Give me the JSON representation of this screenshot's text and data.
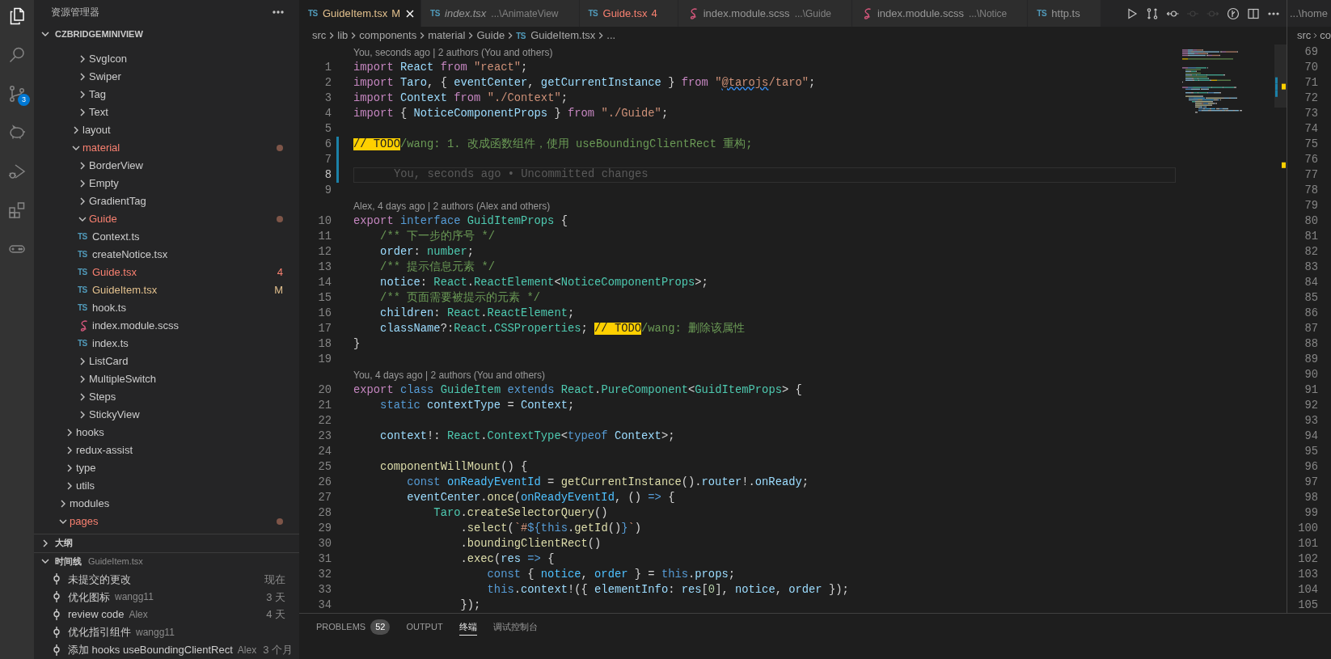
{
  "activity_bar": [
    {
      "kind": "explorer",
      "selected": true
    },
    {
      "kind": "search",
      "selected": false
    },
    {
      "kind": "source-control",
      "selected": false,
      "badge": "3"
    },
    {
      "kind": "piggy",
      "selected": false
    },
    {
      "kind": "run-debug",
      "selected": false
    },
    {
      "kind": "extensions",
      "selected": false
    },
    {
      "kind": "gamepad",
      "selected": false
    }
  ],
  "explorer": {
    "title": "资源管理器",
    "project": {
      "label": "CZBRIDGEMINIVIEW",
      "expanded": true
    },
    "tree": [
      {
        "children": [
          {
            "children": [
              {
                "children": [
                  {
                    "label": "SvgIcon",
                    "kind": "folder",
                    "expanded": false
                  },
                  {
                    "label": "Swiper",
                    "kind": "folder",
                    "expanded": false
                  },
                  {
                    "label": "Tag",
                    "kind": "folder",
                    "expanded": false
                  },
                  {
                    "label": "Text",
                    "kind": "folder",
                    "expanded": false
                  }
                ]
              },
              {
                "label": "layout",
                "kind": "folder",
                "expanded": false
              },
              {
                "label": "material",
                "kind": "folder",
                "expanded": true,
                "problem": true,
                "children": [
                  {
                    "label": "BorderView",
                    "kind": "folder",
                    "expanded": false
                  },
                  {
                    "label": "Empty",
                    "kind": "folder",
                    "expanded": false
                  },
                  {
                    "label": "GradientTag",
                    "kind": "folder",
                    "expanded": false
                  },
                  {
                    "label": "Guide",
                    "kind": "folder",
                    "expanded": true,
                    "problem": true,
                    "children": [
                      {
                        "label": "Context.ts",
                        "kind": "ts-file",
                        "icon": "TS"
                      },
                      {
                        "label": "createNotice.tsx",
                        "kind": "ts-file",
                        "icon": "TS"
                      },
                      {
                        "label": "Guide.tsx",
                        "kind": "ts-file",
                        "icon": "TS",
                        "problem": true,
                        "badge": "4"
                      },
                      {
                        "label": "GuideItem.tsx",
                        "kind": "ts-file",
                        "icon": "TS",
                        "modified": true,
                        "badge": "M"
                      },
                      {
                        "label": "hook.ts",
                        "kind": "ts-file",
                        "icon": "TS"
                      },
                      {
                        "label": "index.module.scss",
                        "kind": "scss-file"
                      },
                      {
                        "label": "index.ts",
                        "kind": "ts-file",
                        "icon": "TS"
                      }
                    ]
                  },
                  {
                    "label": "ListCard",
                    "kind": "folder",
                    "expanded": false
                  },
                  {
                    "label": "MultipleSwitch",
                    "kind": "folder",
                    "expanded": false
                  },
                  {
                    "label": "Steps",
                    "kind": "folder",
                    "expanded": false
                  },
                  {
                    "label": "StickyView",
                    "kind": "folder",
                    "expanded": false
                  }
                ]
              }
            ]
          },
          {
            "label": "hooks",
            "kind": "folder",
            "expanded": false
          },
          {
            "label": "redux-assist",
            "kind": "folder",
            "expanded": false
          },
          {
            "label": "type",
            "kind": "folder",
            "expanded": false
          },
          {
            "label": "utils",
            "kind": "folder",
            "expanded": false
          }
        ]
      },
      {
        "label": "modules",
        "kind": "folder",
        "expanded": false
      },
      {
        "label": "pages",
        "kind": "folder",
        "expanded": true,
        "problem": true
      }
    ]
  },
  "outline": {
    "title": "大纲",
    "expanded": false
  },
  "timeline": {
    "title": "时间线",
    "file": "GuideItem.tsx",
    "expanded": true,
    "items": [
      {
        "title": "未提交的更改",
        "time": "现在"
      },
      {
        "title": "优化图标",
        "author": "wangg11",
        "time": "3 天"
      },
      {
        "title": "review code",
        "author": "Alex",
        "time": "4 天"
      },
      {
        "title": "优化指引组件",
        "author": "wangg11"
      },
      {
        "title": "添加 hooks useBoundingClientRect",
        "author": "Alex",
        "time": "3 个月"
      }
    ]
  },
  "tabs": [
    {
      "kind": "ts-file",
      "icon": "TS",
      "label": "GuideItem.tsx",
      "badge": "M",
      "modified": true,
      "selected": true,
      "preview": false
    },
    {
      "kind": "ts-file",
      "icon": "TS",
      "label": "index.tsx",
      "path": "...\\AnimateView",
      "selected": false,
      "preview": true
    },
    {
      "kind": "ts-file",
      "icon": "TS",
      "label": "Guide.tsx",
      "badge": "4",
      "problem": true,
      "selected": false,
      "preview": false
    },
    {
      "kind": "scss-file",
      "label": "index.module.scss",
      "path": "...\\Guide",
      "selected": false,
      "preview": false
    },
    {
      "kind": "scss-file",
      "label": "index.module.scss",
      "path": "...\\Notice",
      "selected": false,
      "preview": false
    },
    {
      "kind": "ts-file",
      "icon": "TS",
      "label": "http.ts",
      "selected": false,
      "preview": false
    }
  ],
  "editor_actions": [
    {
      "kind": "run",
      "disabled": false
    },
    {
      "kind": "compare",
      "disabled": false
    },
    {
      "kind": "commit-back",
      "disabled": false
    },
    {
      "kind": "commit",
      "disabled": true
    },
    {
      "kind": "commit-forward",
      "disabled": true
    },
    {
      "kind": "graph",
      "disabled": false
    },
    {
      "kind": "split",
      "disabled": false
    },
    {
      "kind": "more",
      "disabled": false
    }
  ],
  "breadcrumbs": [
    {
      "label": "src"
    },
    {
      "label": "lib"
    },
    {
      "label": "components"
    },
    {
      "label": "material"
    },
    {
      "label": "Guide"
    },
    {
      "label": "GuideItem.tsx",
      "kind": "ts-file",
      "icon": "TS"
    },
    {
      "label": "..."
    }
  ],
  "code": {
    "rows": [
      {
        "kind": "lens",
        "text": "You, seconds ago | 2 authors (You and others)"
      },
      {
        "kind": "line",
        "n": "1",
        "current": false,
        "modified": false,
        "tokens": [
          {
            "text": "import ",
            "kind": "keyword"
          },
          {
            "text": "React ",
            "kind": "variable"
          },
          {
            "text": "from ",
            "kind": "keyword"
          },
          {
            "text": "\"react\"",
            "kind": "string"
          },
          {
            "text": ";",
            "kind": "plain"
          }
        ]
      },
      {
        "kind": "line",
        "n": "2",
        "current": false,
        "modified": false,
        "tokens": [
          {
            "text": "import ",
            "kind": "keyword"
          },
          {
            "text": "Taro",
            "kind": "variable"
          },
          {
            "text": ", { ",
            "kind": "plain"
          },
          {
            "text": "eventCenter",
            "kind": "variable"
          },
          {
            "text": ", ",
            "kind": "plain"
          },
          {
            "text": "getCurrentInstance",
            "kind": "variable"
          },
          {
            "text": " } ",
            "kind": "plain"
          },
          {
            "text": "from ",
            "kind": "keyword"
          },
          {
            "text": "\"",
            "kind": "string"
          },
          {
            "text": "@tarojs",
            "kind": "warning"
          },
          {
            "text": "/taro\"",
            "kind": "string"
          },
          {
            "text": ";",
            "kind": "plain"
          }
        ]
      },
      {
        "kind": "line",
        "n": "3",
        "current": false,
        "modified": false,
        "tokens": [
          {
            "text": "import ",
            "kind": "keyword"
          },
          {
            "text": "Context ",
            "kind": "variable"
          },
          {
            "text": "from ",
            "kind": "keyword"
          },
          {
            "text": "\"./Context\"",
            "kind": "string"
          },
          {
            "text": ";",
            "kind": "plain"
          }
        ]
      },
      {
        "kind": "line",
        "n": "4",
        "current": false,
        "modified": false,
        "tokens": [
          {
            "text": "import ",
            "kind": "keyword"
          },
          {
            "text": "{ ",
            "kind": "plain"
          },
          {
            "text": "NoticeComponentProps",
            "kind": "variable"
          },
          {
            "text": " } ",
            "kind": "plain"
          },
          {
            "text": "from ",
            "kind": "keyword"
          },
          {
            "text": "\"./Guide\"",
            "kind": "string"
          },
          {
            "text": ";",
            "kind": "plain"
          }
        ]
      },
      {
        "kind": "line",
        "n": "5",
        "current": false,
        "modified": false
      },
      {
        "kind": "line",
        "n": "6",
        "current": false,
        "modified": true,
        "tokens": [
          {
            "text": "// TODO",
            "kind": "todo"
          },
          {
            "text": "/wang: 1. 改成函数组件，使用 useBoundingClientRect 重构;",
            "kind": "comment"
          }
        ]
      },
      {
        "kind": "line",
        "n": "7",
        "current": false,
        "modified": true
      },
      {
        "kind": "line",
        "n": "8",
        "current": true,
        "modified": true,
        "blame": "You, seconds ago • Uncommitted changes"
      },
      {
        "kind": "line",
        "n": "9",
        "current": false,
        "modified": false
      },
      {
        "kind": "lens",
        "text": "Alex, 4 days ago | 2 authors (Alex and others)"
      },
      {
        "kind": "line",
        "n": "10",
        "current": false,
        "modified": false,
        "tokens": [
          {
            "text": "export ",
            "kind": "keyword"
          },
          {
            "text": "interface ",
            "kind": "storage"
          },
          {
            "text": "GuidItemProps",
            "kind": "type"
          },
          {
            "text": " {",
            "kind": "plain"
          }
        ]
      },
      {
        "kind": "line",
        "n": "11",
        "current": false,
        "modified": false,
        "tokens": [
          {
            "text": "    /** 下一步的序号 */",
            "kind": "comment"
          }
        ]
      },
      {
        "kind": "line",
        "n": "12",
        "current": false,
        "modified": false,
        "tokens": [
          {
            "text": "    order",
            "kind": "variable"
          },
          {
            "text": ": ",
            "kind": "plain"
          },
          {
            "text": "number",
            "kind": "type"
          },
          {
            "text": ";",
            "kind": "plain"
          }
        ]
      },
      {
        "kind": "line",
        "n": "13",
        "current": false,
        "modified": false,
        "tokens": [
          {
            "text": "    /** 提示信息元素 */",
            "kind": "comment"
          }
        ]
      },
      {
        "kind": "line",
        "n": "14",
        "current": false,
        "modified": false,
        "tokens": [
          {
            "text": "    notice",
            "kind": "variable"
          },
          {
            "text": ": ",
            "kind": "plain"
          },
          {
            "text": "React",
            "kind": "type"
          },
          {
            "text": ".",
            "kind": "plain"
          },
          {
            "text": "ReactElement",
            "kind": "type"
          },
          {
            "text": "<",
            "kind": "plain"
          },
          {
            "text": "NoticeComponentProps",
            "kind": "type"
          },
          {
            "text": ">;",
            "kind": "plain"
          }
        ]
      },
      {
        "kind": "line",
        "n": "15",
        "current": false,
        "modified": false,
        "tokens": [
          {
            "text": "    /** 页面需要被提示的元素 */",
            "kind": "comment"
          }
        ]
      },
      {
        "kind": "line",
        "n": "16",
        "current": false,
        "modified": false,
        "tokens": [
          {
            "text": "    children",
            "kind": "variable"
          },
          {
            "text": ": ",
            "kind": "plain"
          },
          {
            "text": "React",
            "kind": "type"
          },
          {
            "text": ".",
            "kind": "plain"
          },
          {
            "text": "ReactElement",
            "kind": "type"
          },
          {
            "text": ";",
            "kind": "plain"
          }
        ]
      },
      {
        "kind": "line",
        "n": "17",
        "current": false,
        "modified": false,
        "tokens": [
          {
            "text": "    className",
            "kind": "variable"
          },
          {
            "text": "?:",
            "kind": "plain"
          },
          {
            "text": "React",
            "kind": "type"
          },
          {
            "text": ".",
            "kind": "plain"
          },
          {
            "text": "CSSProperties",
            "kind": "type"
          },
          {
            "text": "; ",
            "kind": "plain"
          },
          {
            "text": "// TODO",
            "kind": "todo"
          },
          {
            "text": "/wang: 删除该属性",
            "kind": "comment"
          }
        ]
      },
      {
        "kind": "line",
        "n": "18",
        "current": false,
        "modified": false,
        "tokens": [
          {
            "text": "}",
            "kind": "plain"
          }
        ]
      },
      {
        "kind": "line",
        "n": "19",
        "current": false,
        "modified": false
      },
      {
        "kind": "lens",
        "text": "You, 4 days ago | 2 authors (You and others)"
      },
      {
        "kind": "line",
        "n": "20",
        "current": false,
        "modified": false,
        "tokens": [
          {
            "text": "export ",
            "kind": "keyword"
          },
          {
            "text": "class ",
            "kind": "storage"
          },
          {
            "text": "GuideItem ",
            "kind": "type"
          },
          {
            "text": "extends ",
            "kind": "storage"
          },
          {
            "text": "React",
            "kind": "type"
          },
          {
            "text": ".",
            "kind": "plain"
          },
          {
            "text": "PureComponent",
            "kind": "type"
          },
          {
            "text": "<",
            "kind": "plain"
          },
          {
            "text": "GuidItemProps",
            "kind": "type"
          },
          {
            "text": "> {",
            "kind": "plain"
          }
        ]
      },
      {
        "kind": "line",
        "n": "21",
        "current": false,
        "modified": false,
        "tokens": [
          {
            "text": "    static ",
            "kind": "storage"
          },
          {
            "text": "contextType",
            "kind": "variable"
          },
          {
            "text": " = ",
            "kind": "plain"
          },
          {
            "text": "Context",
            "kind": "variable"
          },
          {
            "text": ";",
            "kind": "plain"
          }
        ]
      },
      {
        "kind": "line",
        "n": "22",
        "current": false,
        "modified": false
      },
      {
        "kind": "line",
        "n": "23",
        "current": false,
        "modified": false,
        "tokens": [
          {
            "text": "    context",
            "kind": "variable"
          },
          {
            "text": "!: ",
            "kind": "plain"
          },
          {
            "text": "React",
            "kind": "type"
          },
          {
            "text": ".",
            "kind": "plain"
          },
          {
            "text": "ContextType",
            "kind": "type"
          },
          {
            "text": "<",
            "kind": "plain"
          },
          {
            "text": "typeof ",
            "kind": "storage"
          },
          {
            "text": "Context",
            "kind": "variable"
          },
          {
            "text": ">;",
            "kind": "plain"
          }
        ]
      },
      {
        "kind": "line",
        "n": "24",
        "current": false,
        "modified": false
      },
      {
        "kind": "line",
        "n": "25",
        "current": false,
        "modified": false,
        "tokens": [
          {
            "text": "    componentWillMount",
            "kind": "function"
          },
          {
            "text": "() {",
            "kind": "plain"
          }
        ]
      },
      {
        "kind": "line",
        "n": "26",
        "current": false,
        "modified": false,
        "tokens": [
          {
            "text": "        const ",
            "kind": "storage"
          },
          {
            "text": "onReadyEventId",
            "kind": "constant"
          },
          {
            "text": " = ",
            "kind": "plain"
          },
          {
            "text": "getCurrentInstance",
            "kind": "function"
          },
          {
            "text": "().",
            "kind": "plain"
          },
          {
            "text": "router",
            "kind": "variable"
          },
          {
            "text": "!.",
            "kind": "plain"
          },
          {
            "text": "onReady",
            "kind": "variable"
          },
          {
            "text": ";",
            "kind": "plain"
          }
        ]
      },
      {
        "kind": "line",
        "n": "27",
        "current": false,
        "modified": false,
        "tokens": [
          {
            "text": "        eventCenter",
            "kind": "variable"
          },
          {
            "text": ".",
            "kind": "plain"
          },
          {
            "text": "once",
            "kind": "function"
          },
          {
            "text": "(",
            "kind": "plain"
          },
          {
            "text": "onReadyEventId",
            "kind": "constant"
          },
          {
            "text": ", () ",
            "kind": "plain"
          },
          {
            "text": "=>",
            "kind": "storage"
          },
          {
            "text": " {",
            "kind": "plain"
          }
        ]
      },
      {
        "kind": "line",
        "n": "28",
        "current": false,
        "modified": false,
        "tokens": [
          {
            "text": "            Taro",
            "kind": "type"
          },
          {
            "text": ".",
            "kind": "plain"
          },
          {
            "text": "createSelectorQuery",
            "kind": "function"
          },
          {
            "text": "()",
            "kind": "plain"
          }
        ]
      },
      {
        "kind": "line",
        "n": "29",
        "current": false,
        "modified": false,
        "tokens": [
          {
            "text": "                .",
            "kind": "plain"
          },
          {
            "text": "select",
            "kind": "function"
          },
          {
            "text": "(",
            "kind": "plain"
          },
          {
            "text": "`#",
            "kind": "string"
          },
          {
            "text": "${",
            "kind": "storage"
          },
          {
            "text": "this",
            "kind": "storage"
          },
          {
            "text": ".",
            "kind": "plain"
          },
          {
            "text": "getId",
            "kind": "function"
          },
          {
            "text": "()",
            "kind": "plain"
          },
          {
            "text": "}",
            "kind": "storage"
          },
          {
            "text": "`",
            "kind": "string"
          },
          {
            "text": ")",
            "kind": "plain"
          }
        ]
      },
      {
        "kind": "line",
        "n": "30",
        "current": false,
        "modified": false,
        "tokens": [
          {
            "text": "                .",
            "kind": "plain"
          },
          {
            "text": "boundingClientRect",
            "kind": "function"
          },
          {
            "text": "()",
            "kind": "plain"
          }
        ]
      },
      {
        "kind": "line",
        "n": "31",
        "current": false,
        "modified": false,
        "tokens": [
          {
            "text": "                .",
            "kind": "plain"
          },
          {
            "text": "exec",
            "kind": "function"
          },
          {
            "text": "(",
            "kind": "plain"
          },
          {
            "text": "res",
            "kind": "variable"
          },
          {
            "text": " => ",
            "kind": "storage"
          },
          {
            "text": "{",
            "kind": "plain"
          }
        ]
      },
      {
        "kind": "line",
        "n": "32",
        "current": false,
        "modified": false,
        "tokens": [
          {
            "text": "                    const ",
            "kind": "storage"
          },
          {
            "text": "{ ",
            "kind": "plain"
          },
          {
            "text": "notice",
            "kind": "constant"
          },
          {
            "text": ", ",
            "kind": "plain"
          },
          {
            "text": "order",
            "kind": "constant"
          },
          {
            "text": " } = ",
            "kind": "plain"
          },
          {
            "text": "this",
            "kind": "storage"
          },
          {
            "text": ".",
            "kind": "plain"
          },
          {
            "text": "props",
            "kind": "variable"
          },
          {
            "text": ";",
            "kind": "plain"
          }
        ]
      },
      {
        "kind": "line",
        "n": "33",
        "current": false,
        "modified": false,
        "tokens": [
          {
            "text": "                    this",
            "kind": "storage"
          },
          {
            "text": ".",
            "kind": "plain"
          },
          {
            "text": "context",
            "kind": "variable"
          },
          {
            "text": "!({ ",
            "kind": "plain"
          },
          {
            "text": "elementInfo",
            "kind": "variable"
          },
          {
            "text": ": ",
            "kind": "plain"
          },
          {
            "text": "res",
            "kind": "variable"
          },
          {
            "text": "[",
            "kind": "plain"
          },
          {
            "text": "0",
            "kind": "number"
          },
          {
            "text": "], ",
            "kind": "plain"
          },
          {
            "text": "notice",
            "kind": "variable"
          },
          {
            "text": ", ",
            "kind": "plain"
          },
          {
            "text": "order",
            "kind": "variable"
          },
          {
            "text": " });",
            "kind": "plain"
          }
        ]
      },
      {
        "kind": "line",
        "n": "34",
        "current": false,
        "modified": false,
        "tokens": [
          {
            "text": "                });",
            "kind": "plain"
          }
        ]
      }
    ]
  },
  "second_group": {
    "tab": "...\\home",
    "breadcrumbs": [
      "src",
      "co"
    ],
    "line_numbers": [
      "69",
      "70",
      "71",
      "72",
      "73",
      "74",
      "75",
      "76",
      "77",
      "78",
      "79",
      "80",
      "81",
      "82",
      "83",
      "84",
      "85",
      "86",
      "87",
      "88",
      "89",
      "90",
      "91",
      "92",
      "93",
      "94",
      "95",
      "96",
      "97",
      "98",
      "99",
      "100",
      "101",
      "102",
      "103",
      "104",
      "105"
    ]
  },
  "panel": {
    "tabs": [
      {
        "label": "PROBLEMS",
        "count": "52",
        "selected": false
      },
      {
        "label": "OUTPUT",
        "selected": false
      },
      {
        "label": "终端",
        "selected": true
      },
      {
        "label": "调试控制台",
        "selected": false
      }
    ]
  }
}
